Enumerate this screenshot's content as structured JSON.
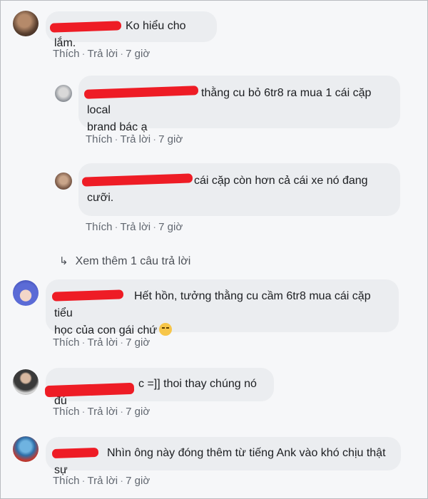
{
  "comments": [
    {
      "text": "Ko hiểu cho lắm.",
      "actions": {
        "like": "Thích",
        "reply": "Trả lời",
        "time": "7 giờ"
      }
    },
    {
      "text_line1": "thằng cu bỏ 6tr8 ra mua 1 cái cặp local",
      "text_line2": "brand bác ạ",
      "actions": {
        "like": "Thích",
        "reply": "Trả lời",
        "time": "7 giờ"
      }
    },
    {
      "text_line1": "cái cặp còn hơn cả cái xe nó đang",
      "text_line2": "cưỡi.",
      "actions": {
        "like": "Thích",
        "reply": "Trả lời",
        "time": "7 giờ"
      }
    },
    {
      "text_line1": "Hết hồn, tưởng thằng cu cầm 6tr8 mua cái cặp tiểu",
      "text_line2": "học của con gái chứ",
      "actions": {
        "like": "Thích",
        "reply": "Trả lời",
        "time": "7 giờ"
      }
    },
    {
      "text": "c =]] thoi thay chúng nó đú",
      "actions": {
        "like": "Thích",
        "reply": "Trả lời",
        "time": "7 giờ"
      }
    },
    {
      "text": "Nhìn ông này đóng thêm từ tiếng Ank vào khó chịu thật sự",
      "actions": {
        "like": "Thích",
        "reply": "Trả lời",
        "time": "7 giờ"
      }
    }
  ],
  "view_more": "Xem thêm 1 câu trả lời",
  "colors": {
    "name": "#385898",
    "redaction": "#ee1c25",
    "bubble": "#ebedf0",
    "meta": "#616770"
  }
}
